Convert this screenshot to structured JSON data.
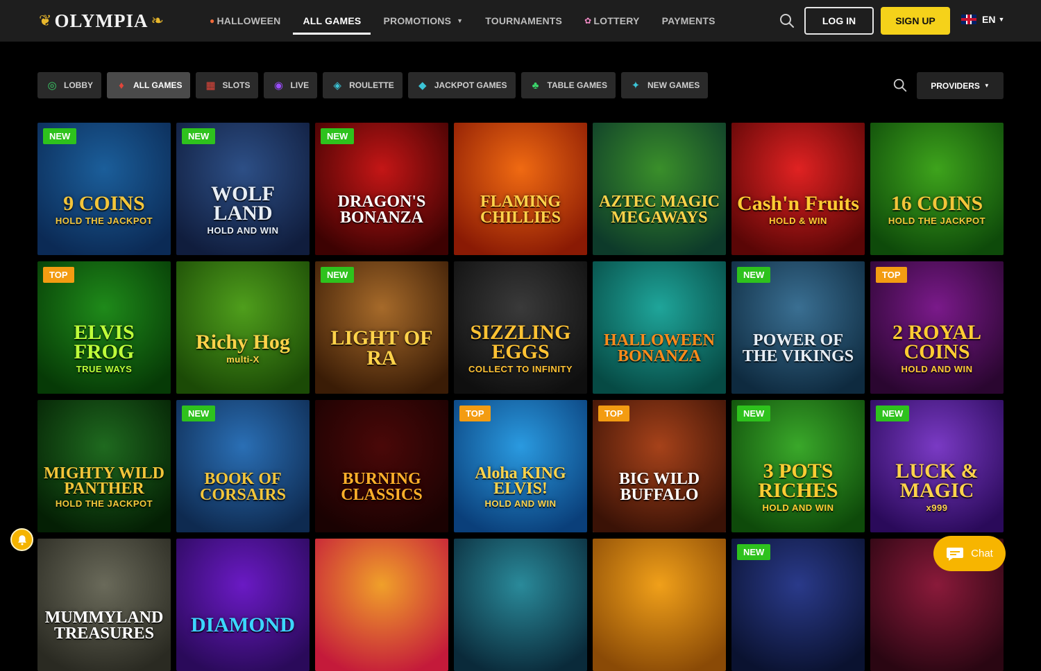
{
  "header": {
    "logo_text": "OLYMPIA",
    "nav": [
      {
        "label": "HALLOWEEN",
        "icon": "pumpkin-icon",
        "active": false,
        "caret": false
      },
      {
        "label": "ALL GAMES",
        "icon": "",
        "active": true,
        "caret": false
      },
      {
        "label": "PROMOTIONS",
        "icon": "",
        "active": false,
        "caret": true
      },
      {
        "label": "TOURNAMENTS",
        "icon": "",
        "active": false,
        "caret": false
      },
      {
        "label": "LOTTERY",
        "icon": "flower-icon",
        "active": false,
        "caret": false
      },
      {
        "label": "PAYMENTS",
        "icon": "",
        "active": false,
        "caret": false
      }
    ],
    "login_label": "LOG IN",
    "signup_label": "SIGN UP",
    "language": "EN"
  },
  "categories": [
    {
      "label": "LOBBY",
      "icon": "chips-icon",
      "color": "#3bd36a",
      "active": false
    },
    {
      "label": "ALL GAMES",
      "icon": "cards-icon",
      "color": "#e0453a",
      "active": true
    },
    {
      "label": "SLOTS",
      "icon": "slot-icon",
      "color": "#e0453a",
      "active": false
    },
    {
      "label": "LIVE",
      "icon": "live-icon",
      "color": "#9b4dff",
      "active": false
    },
    {
      "label": "ROULETTE",
      "icon": "roulette-icon",
      "color": "#3cc4d6",
      "active": false
    },
    {
      "label": "JACKPOT GAMES",
      "icon": "jackpot-icon",
      "color": "#3cc4d6",
      "active": false
    },
    {
      "label": "TABLE GAMES",
      "icon": "table-icon",
      "color": "#3bd36a",
      "active": false
    },
    {
      "label": "NEW GAMES",
      "icon": "new-icon",
      "color": "#3cc4d6",
      "active": false
    }
  ],
  "providers_label": "PROVIDERS",
  "games": [
    {
      "title": "9 COINS",
      "subtitle": "HOLD THE JACKPOT",
      "badge": "NEW",
      "bg1": "#1b5e9a",
      "bg2": "#0b2a55",
      "fg": "#f3c53a"
    },
    {
      "title": "WOLF LAND",
      "subtitle": "HOLD AND WIN",
      "badge": "NEW",
      "bg1": "#2d4f86",
      "bg2": "#101d3d",
      "fg": "#e8eef5"
    },
    {
      "title": "DRAGON'S BONANZA",
      "subtitle": "",
      "badge": "NEW",
      "bg1": "#c41616",
      "bg2": "#3d0202",
      "fg": "#ffffff"
    },
    {
      "title": "FLAMING CHILLIES",
      "subtitle": "",
      "badge": "",
      "bg1": "#f06a12",
      "bg2": "#8a1a04",
      "fg": "#ffd34a"
    },
    {
      "title": "AZTEC MAGIC MEGAWAYS",
      "subtitle": "",
      "badge": "",
      "bg1": "#3a8f2a",
      "bg2": "#0d3a2a",
      "fg": "#ffd34a"
    },
    {
      "title": "Cash'n Fruits",
      "subtitle": "HOLD & WIN",
      "badge": "",
      "bg1": "#e02222",
      "bg2": "#5a0606",
      "fg": "#ffcc33"
    },
    {
      "title": "16 COINS",
      "subtitle": "HOLD THE JACKPOT",
      "badge": "",
      "bg1": "#3ea31c",
      "bg2": "#0e4a0a",
      "fg": "#f3c53a"
    },
    {
      "title": "ELVIS FROG",
      "subtitle": "TRUE WAYS",
      "badge": "TOP",
      "bg1": "#1f8a1a",
      "bg2": "#063a06",
      "fg": "#bfff3a"
    },
    {
      "title": "Richy Hog",
      "subtitle": "multi-X",
      "badge": "",
      "bg1": "#4f9e1c",
      "bg2": "#1b4a06",
      "fg": "#ffd34a"
    },
    {
      "title": "LIGHT OF RA",
      "subtitle": "",
      "badge": "NEW",
      "bg1": "#a66a2a",
      "bg2": "#3a1c06",
      "fg": "#ffd34a"
    },
    {
      "title": "SIZZLING EGGS",
      "subtitle": "COLLECT TO INFINITY",
      "badge": "",
      "bg1": "#3a3a3a",
      "bg2": "#0f0f0f",
      "fg": "#ffc233"
    },
    {
      "title": "HALLOWEEN BONANZA",
      "subtitle": "",
      "badge": "",
      "bg1": "#1fa59a",
      "bg2": "#064a44",
      "fg": "#ff8a1a"
    },
    {
      "title": "POWER OF THE VIKINGS",
      "subtitle": "",
      "badge": "NEW",
      "bg1": "#3a6f92",
      "bg2": "#0e2a3f",
      "fg": "#e8eef5"
    },
    {
      "title": "2 ROYAL COINS",
      "subtitle": "HOLD AND WIN",
      "badge": "TOP",
      "bg1": "#7a1a8a",
      "bg2": "#2a0630",
      "fg": "#ffcc33"
    },
    {
      "title": "MIGHTY WILD PANTHER",
      "subtitle": "HOLD THE JACKPOT",
      "badge": "",
      "bg1": "#1f6a1f",
      "bg2": "#041f04",
      "fg": "#f3c53a"
    },
    {
      "title": "BOOK OF CORSAIRS",
      "subtitle": "",
      "badge": "NEW",
      "bg1": "#2a6fb5",
      "bg2": "#0e2a50",
      "fg": "#f3c53a"
    },
    {
      "title": "BURNING CLASSICS",
      "subtitle": "",
      "badge": "",
      "bg1": "#4a0808",
      "bg2": "#1a0202",
      "fg": "#ffb02a"
    },
    {
      "title": "Aloha KING ELVIS!",
      "subtitle": "HOLD AND WIN",
      "badge": "TOP",
      "bg1": "#2a9ae0",
      "bg2": "#0a3f7a",
      "fg": "#ffd34a"
    },
    {
      "title": "BIG WILD BUFFALO",
      "subtitle": "",
      "badge": "TOP",
      "bg1": "#a6421a",
      "bg2": "#3a1206",
      "fg": "#ffffff"
    },
    {
      "title": "3 POTS RICHES",
      "subtitle": "HOLD AND WIN",
      "badge": "NEW",
      "bg1": "#3aa82a",
      "bg2": "#0e4a0a",
      "fg": "#ffcc33"
    },
    {
      "title": "LUCK & MAGIC",
      "subtitle": "x999",
      "badge": "NEW",
      "bg1": "#7a3ac4",
      "bg2": "#2a0a5a",
      "fg": "#ffd34a"
    },
    {
      "title": "MUMMYLAND TREASURES",
      "subtitle": "",
      "badge": "",
      "bg1": "#6a6a5a",
      "bg2": "#2a2a22",
      "fg": "#ffffff"
    },
    {
      "title": "DIAMOND",
      "subtitle": "",
      "badge": "",
      "bg1": "#6a1ac4",
      "bg2": "#2a0a5a",
      "fg": "#3cd6ff"
    },
    {
      "title": "",
      "subtitle": "",
      "badge": "",
      "bg1": "#f0a02a",
      "bg2": "#c41a3a",
      "fg": "#ffffff"
    },
    {
      "title": "",
      "subtitle": "",
      "badge": "",
      "bg1": "#2a8a9a",
      "bg2": "#0a2a3a",
      "fg": "#ffffff"
    },
    {
      "title": "",
      "subtitle": "",
      "badge": "",
      "bg1": "#f0a01a",
      "bg2": "#8a4a06",
      "fg": "#ffffff"
    },
    {
      "title": "",
      "subtitle": "",
      "badge": "NEW",
      "bg1": "#2a3a8a",
      "bg2": "#0a1230",
      "fg": "#ffffff"
    },
    {
      "title": "",
      "subtitle": "",
      "badge": "",
      "bg1": "#8a1a3a",
      "bg2": "#2a0612",
      "fg": "#ffffff"
    }
  ],
  "chat_label": "Chat"
}
